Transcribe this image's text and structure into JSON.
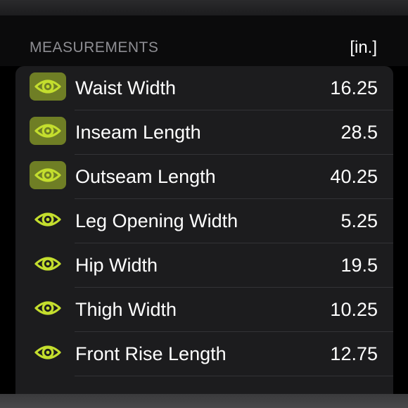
{
  "header": {
    "title": "MEASUREMENTS",
    "unit": "[in.]"
  },
  "colors": {
    "accent": "#c4de2e",
    "active_bg": "#6f7e25",
    "card_bg": "#1c1c1e"
  },
  "measurements": [
    {
      "label": "Waist Width",
      "value": "16.25",
      "icon": "eye-icon",
      "active": true
    },
    {
      "label": "Inseam Length",
      "value": "28.5",
      "icon": "eye-icon",
      "active": true
    },
    {
      "label": "Outseam Length",
      "value": "40.25",
      "icon": "eye-icon",
      "active": true
    },
    {
      "label": "Leg Opening Width",
      "value": "5.25",
      "icon": "eye-icon",
      "active": false
    },
    {
      "label": "Hip Width",
      "value": "19.5",
      "icon": "eye-icon",
      "active": false
    },
    {
      "label": "Thigh Width",
      "value": "10.25",
      "icon": "eye-icon",
      "active": false
    },
    {
      "label": "Front Rise Length",
      "value": "12.75",
      "icon": "eye-icon",
      "active": false
    }
  ]
}
